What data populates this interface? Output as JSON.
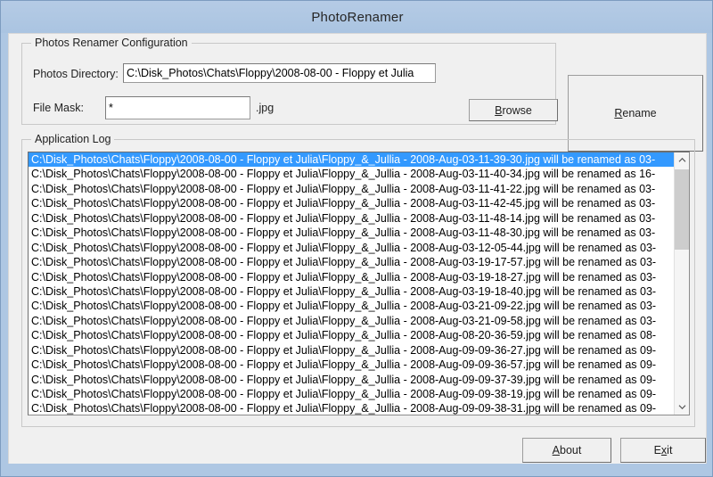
{
  "window": {
    "title": "PhotoRenamer"
  },
  "config_group": {
    "title": "Photos Renamer Configuration",
    "directory_label": "Photos Directory:",
    "directory_value": "C:\\Disk_Photos\\Chats\\Floppy\\2008-08-00 - Floppy et Julia",
    "directory_placeholder": "",
    "browse_label_prefix": "",
    "browse_accel": "B",
    "browse_label_suffix": "rowse",
    "mask_label": "File Mask:",
    "mask_value": "*",
    "mask_placeholder": "",
    "mask_suffix": ".jpg"
  },
  "rename_button": {
    "accel": "R",
    "label_suffix": "ename"
  },
  "log_group": {
    "title": "Application Log",
    "rows": [
      "C:\\Disk_Photos\\Chats\\Floppy\\2008-08-00 - Floppy et Julia\\Floppy_&_Jullia - 2008-Aug-03-11-39-30.jpg will be renamed as 03-",
      "C:\\Disk_Photos\\Chats\\Floppy\\2008-08-00 - Floppy et Julia\\Floppy_&_Jullia - 2008-Aug-03-11-40-34.jpg will be renamed as 16-",
      "C:\\Disk_Photos\\Chats\\Floppy\\2008-08-00 - Floppy et Julia\\Floppy_&_Jullia - 2008-Aug-03-11-41-22.jpg will be renamed as 03-",
      "C:\\Disk_Photos\\Chats\\Floppy\\2008-08-00 - Floppy et Julia\\Floppy_&_Jullia - 2008-Aug-03-11-42-45.jpg will be renamed as 03-",
      "C:\\Disk_Photos\\Chats\\Floppy\\2008-08-00 - Floppy et Julia\\Floppy_&_Jullia - 2008-Aug-03-11-48-14.jpg will be renamed as 03-",
      "C:\\Disk_Photos\\Chats\\Floppy\\2008-08-00 - Floppy et Julia\\Floppy_&_Jullia - 2008-Aug-03-11-48-30.jpg will be renamed as 03-",
      "C:\\Disk_Photos\\Chats\\Floppy\\2008-08-00 - Floppy et Julia\\Floppy_&_Jullia - 2008-Aug-03-12-05-44.jpg will be renamed as 03-",
      "C:\\Disk_Photos\\Chats\\Floppy\\2008-08-00 - Floppy et Julia\\Floppy_&_Jullia - 2008-Aug-03-19-17-57.jpg will be renamed as 03-",
      "C:\\Disk_Photos\\Chats\\Floppy\\2008-08-00 - Floppy et Julia\\Floppy_&_Jullia - 2008-Aug-03-19-18-27.jpg will be renamed as 03-",
      "C:\\Disk_Photos\\Chats\\Floppy\\2008-08-00 - Floppy et Julia\\Floppy_&_Jullia - 2008-Aug-03-19-18-40.jpg will be renamed as 03-",
      "C:\\Disk_Photos\\Chats\\Floppy\\2008-08-00 - Floppy et Julia\\Floppy_&_Jullia - 2008-Aug-03-21-09-22.jpg will be renamed as 03-",
      "C:\\Disk_Photos\\Chats\\Floppy\\2008-08-00 - Floppy et Julia\\Floppy_&_Jullia - 2008-Aug-03-21-09-58.jpg will be renamed as 03-",
      "C:\\Disk_Photos\\Chats\\Floppy\\2008-08-00 - Floppy et Julia\\Floppy_&_Jullia - 2008-Aug-08-20-36-59.jpg will be renamed as 08-",
      "C:\\Disk_Photos\\Chats\\Floppy\\2008-08-00 - Floppy et Julia\\Floppy_&_Jullia - 2008-Aug-09-09-36-27.jpg will be renamed as 09-",
      "C:\\Disk_Photos\\Chats\\Floppy\\2008-08-00 - Floppy et Julia\\Floppy_&_Jullia - 2008-Aug-09-09-36-57.jpg will be renamed as 09-",
      "C:\\Disk_Photos\\Chats\\Floppy\\2008-08-00 - Floppy et Julia\\Floppy_&_Jullia - 2008-Aug-09-09-37-39.jpg will be renamed as 09-",
      "C:\\Disk_Photos\\Chats\\Floppy\\2008-08-00 - Floppy et Julia\\Floppy_&_Jullia - 2008-Aug-09-09-38-19.jpg will be renamed as 09-",
      "C:\\Disk_Photos\\Chats\\Floppy\\2008-08-00 - Floppy et Julia\\Floppy_&_Jullia - 2008-Aug-09-09-38-31.jpg will be renamed as 09-"
    ],
    "selected_index": 0,
    "scrollbar": {
      "up_icon": "chevron-up",
      "down_icon": "chevron-down"
    }
  },
  "footer": {
    "about_accel": "A",
    "about_suffix": "bout",
    "exit_prefix": "E",
    "exit_accel": "x",
    "exit_suffix": "it"
  },
  "colors": {
    "titlebar": "#aec4e0",
    "selection": "#3399ff",
    "face": "#f0f0f0"
  }
}
